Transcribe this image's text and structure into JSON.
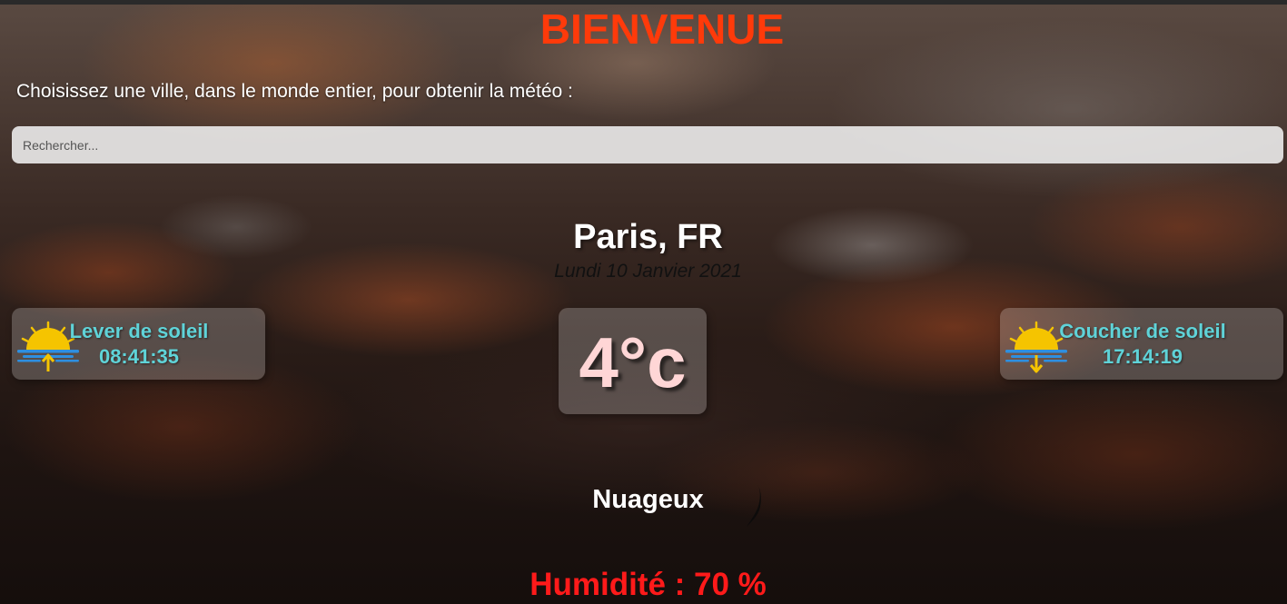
{
  "header": {
    "title": "BIENVENUE",
    "prompt": "Choisissez une ville, dans le monde entier, pour obtenir la météo :"
  },
  "search": {
    "placeholder": "Rechercher...",
    "value": ""
  },
  "location": {
    "city": "Paris, FR",
    "date": "Lundi 10 Janvier 2021"
  },
  "sunrise": {
    "label": "Lever de soleil",
    "time": "08:41:35",
    "icon": "sunrise-icon"
  },
  "sunset": {
    "label": "Coucher de soleil",
    "time": "17:14:19",
    "icon": "sunset-icon"
  },
  "weather": {
    "temperature": "4°c",
    "condition": "Nuageux",
    "condition_icon": "cloud-icon",
    "humidity": "Humidité : 70 %"
  },
  "colors": {
    "title": "#ff3a0a",
    "sun_text": "#5fd3d8",
    "temperature": "#ffd6d6",
    "humidity": "#ff1a1a",
    "sun_icon": "#f5c400",
    "water_icon": "#2e8fe0",
    "arrow_icon": "#f5c400"
  }
}
